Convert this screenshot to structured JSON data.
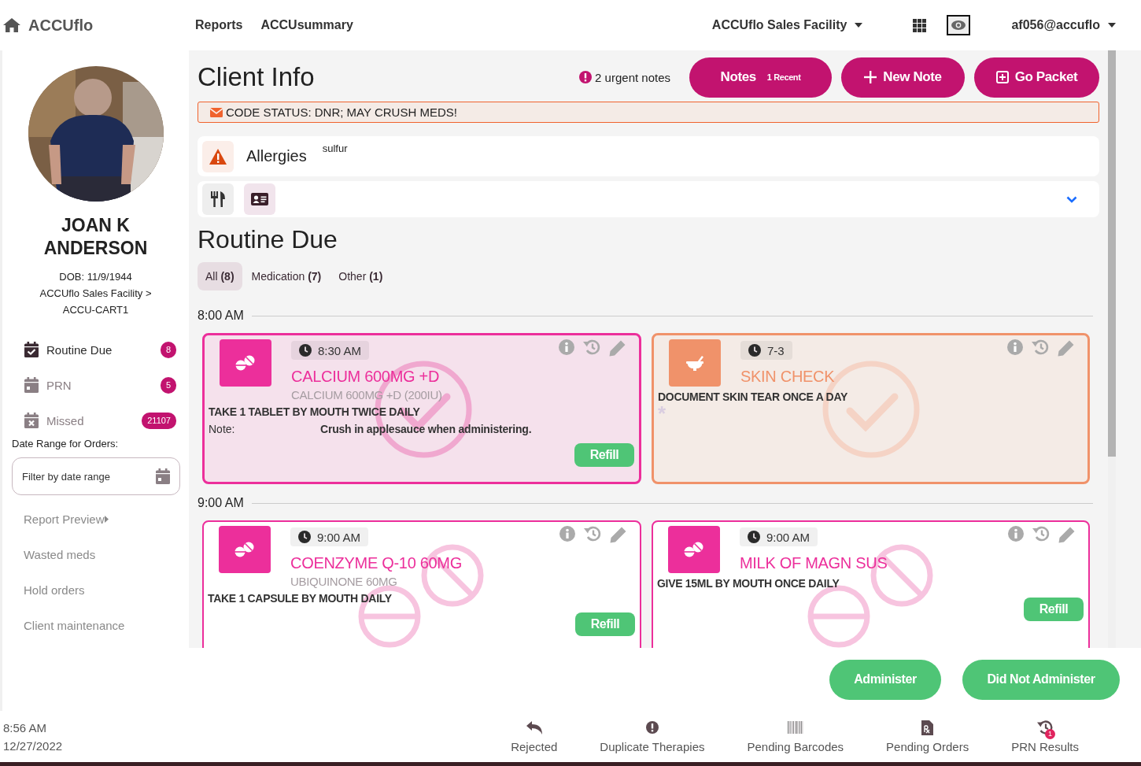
{
  "nav": {
    "brand": "ACCUflo",
    "links": [
      "Reports",
      "ACCUsummary"
    ],
    "facility": "ACCUflo Sales Facility",
    "user": "af056@accuflo"
  },
  "client": {
    "name": "JOAN K ANDERSON",
    "dob": "DOB: 11/9/1944",
    "location": "ACCUflo Sales Facility > ACCU-CART1"
  },
  "sidebar": {
    "items": [
      {
        "label": "Routine Due",
        "badge": "8",
        "selected": true,
        "kind": "due"
      },
      {
        "label": "PRN",
        "badge": "5",
        "selected": false,
        "kind": "prn"
      },
      {
        "label": "Missed",
        "badge": "21107",
        "selected": false,
        "kind": "missed"
      }
    ],
    "date_range": {
      "label": "Date Range for Orders:",
      "placeholder": "Filter by date range"
    },
    "links": [
      {
        "label": "Report Preview",
        "submenu": true
      },
      {
        "label": "Wasted meds",
        "submenu": false
      },
      {
        "label": "Hold orders",
        "submenu": false
      },
      {
        "label": "Client maintenance",
        "submenu": false
      }
    ]
  },
  "header": {
    "title": "Client Info",
    "urgent_notes": "2 urgent notes",
    "buttons": [
      {
        "label": "Notes",
        "badge": "1 Recent",
        "kind": "notes"
      },
      {
        "label": "New Note",
        "kind": "new"
      },
      {
        "label": "Go Packet",
        "kind": "packet"
      }
    ]
  },
  "code_status": "CODE STATUS: DNR; MAY CRUSH MEDS!",
  "allergies": {
    "label": "Allergies",
    "value": "sulfur"
  },
  "section": {
    "title": "Routine Due",
    "filters": [
      {
        "label": "All **(8)**",
        "selected": true
      },
      {
        "label": "Medication **(7)**",
        "selected": false
      },
      {
        "label": "Other **(1)**",
        "selected": false
      }
    ]
  },
  "groups": [
    {
      "time": "8:00 AM",
      "cards": [
        {
          "kind": "medication",
          "done": true,
          "time": "8:30 AM",
          "name": "CALCIUM 600MG +D",
          "generic": "CALCIUM 600MG +D (200IU)",
          "instructions": "TAKE 1 TABLET BY MOUTH TWICE DAILY",
          "note_label": "Note:",
          "note": "Crush in applesauce when administering.",
          "refill": "Refill"
        },
        {
          "kind": "other",
          "done": true,
          "time": "7-3",
          "name": "SKIN CHECK",
          "instructions": "DOCUMENT SKIN TEAR ONCE A DAY",
          "marker": "*"
        }
      ]
    },
    {
      "time": "9:00 AM",
      "cards": [
        {
          "kind": "medication",
          "done": false,
          "time": "9:00 AM",
          "name": "COENZYME Q-10 60MG",
          "generic": "UBIQUINONE 60MG",
          "instructions": "TAKE 1 CAPSULE BY MOUTH DAILY",
          "refill": "Refill"
        },
        {
          "kind": "medication",
          "done": false,
          "time": "9:00 AM",
          "name": "MILK OF MAGN SUS",
          "instructions": "GIVE 15ML BY MOUTH ONCE DAILY",
          "refill": "Refill"
        }
      ]
    }
  ],
  "actions": [
    "Administer",
    "Did Not Administer"
  ],
  "footer": {
    "time": "8:56 AM",
    "date": "12/27/2022",
    "tabs": [
      {
        "label": "Rejected",
        "kind": "rejected"
      },
      {
        "label": "Duplicate Therapies",
        "kind": "duplicate"
      },
      {
        "label": "Pending Barcodes",
        "kind": "barcodes"
      },
      {
        "label": "Pending Orders",
        "kind": "orders"
      },
      {
        "label": "PRN Results",
        "kind": "prn",
        "badge": "1"
      }
    ]
  }
}
